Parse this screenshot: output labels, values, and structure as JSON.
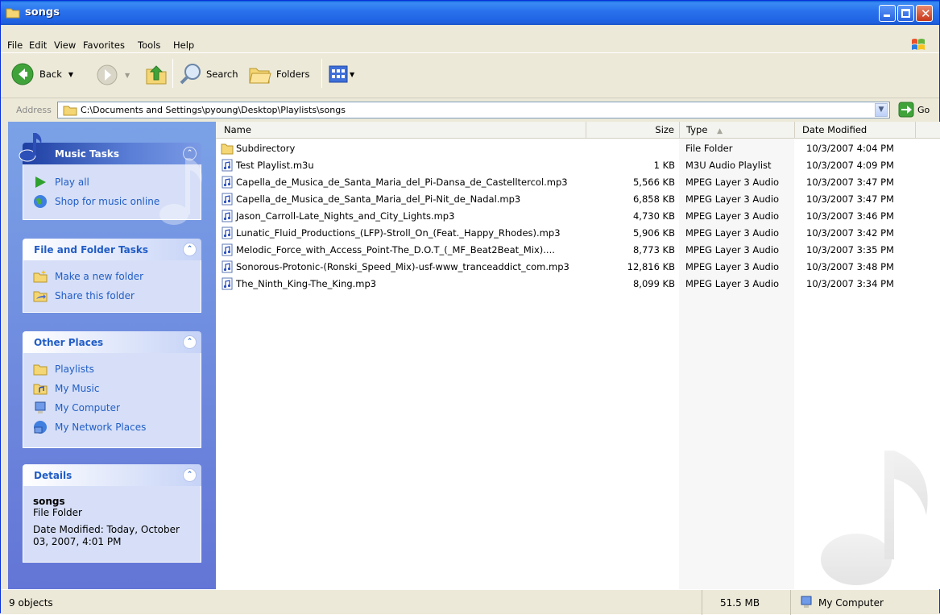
{
  "window": {
    "title": "songs"
  },
  "menu": [
    "File",
    "Edit",
    "View",
    "Favorites",
    "Tools",
    "Help"
  ],
  "toolbar": {
    "back_label": "Back",
    "search_label": "Search",
    "folders_label": "Folders"
  },
  "address": {
    "label": "Address",
    "path": "C:\\Documents and Settings\\pyoung\\Desktop\\Playlists\\songs",
    "go_label": "Go"
  },
  "taskpane": {
    "music_tasks": {
      "title": "Music Tasks",
      "items": [
        "Play all",
        "Shop for music online"
      ]
    },
    "file_folder_tasks": {
      "title": "File and Folder Tasks",
      "items": [
        "Make a new folder",
        "Share this folder"
      ]
    },
    "other_places": {
      "title": "Other Places",
      "items": [
        "Playlists",
        "My Music",
        "My Computer",
        "My Network Places"
      ]
    },
    "details": {
      "title": "Details",
      "name": "songs",
      "type": "File Folder",
      "modified_line1": "Date Modified: Today, October",
      "modified_line2": "03, 2007, 4:01 PM"
    }
  },
  "columns": {
    "name": "Name",
    "size": "Size",
    "type": "Type",
    "date": "Date Modified"
  },
  "files": [
    {
      "name": "Subdirectory",
      "size": "",
      "type": "File Folder",
      "date": "10/3/2007 4:04 PM",
      "icon": "folder-icon"
    },
    {
      "name": "Test Playlist.m3u",
      "size": "1 KB",
      "type": "M3U Audio Playlist",
      "date": "10/3/2007 4:09 PM",
      "icon": "music-file-icon"
    },
    {
      "name": "Capella_de_Musica_de_Santa_Maria_del_Pi-Dansa_de_Castelltercol.mp3",
      "size": "5,566 KB",
      "type": "MPEG Layer 3 Audio",
      "date": "10/3/2007 3:47 PM",
      "icon": "music-file-icon"
    },
    {
      "name": "Capella_de_Musica_de_Santa_Maria_del_Pi-Nit_de_Nadal.mp3",
      "size": "6,858 KB",
      "type": "MPEG Layer 3 Audio",
      "date": "10/3/2007 3:47 PM",
      "icon": "music-file-icon"
    },
    {
      "name": "Jason_Carroll-Late_Nights_and_City_Lights.mp3",
      "size": "4,730 KB",
      "type": "MPEG Layer 3 Audio",
      "date": "10/3/2007 3:46 PM",
      "icon": "music-file-icon"
    },
    {
      "name": "Lunatic_Fluid_Productions_(LFP)-Stroll_On_(Feat._Happy_Rhodes).mp3",
      "size": "5,906 KB",
      "type": "MPEG Layer 3 Audio",
      "date": "10/3/2007 3:42 PM",
      "icon": "music-file-icon"
    },
    {
      "name": "Melodic_Force_with_Access_Point-The_D.O.T_(_MF_Beat2Beat_Mix)....",
      "size": "8,773 KB",
      "type": "MPEG Layer 3 Audio",
      "date": "10/3/2007 3:35 PM",
      "icon": "music-file-icon"
    },
    {
      "name": "Sonorous-Protonic-(Ronski_Speed_Mix)-usf-www_tranceaddict_com.mp3",
      "size": "12,816 KB",
      "type": "MPEG Layer 3 Audio",
      "date": "10/3/2007 3:48 PM",
      "icon": "music-file-icon"
    },
    {
      "name": "The_Ninth_King-The_King.mp3",
      "size": "8,099 KB",
      "type": "MPEG Layer 3 Audio",
      "date": "10/3/2007 3:34 PM",
      "icon": "music-file-icon"
    }
  ],
  "status": {
    "objects": "9 objects",
    "size": "51.5 MB",
    "location": "My Computer"
  }
}
